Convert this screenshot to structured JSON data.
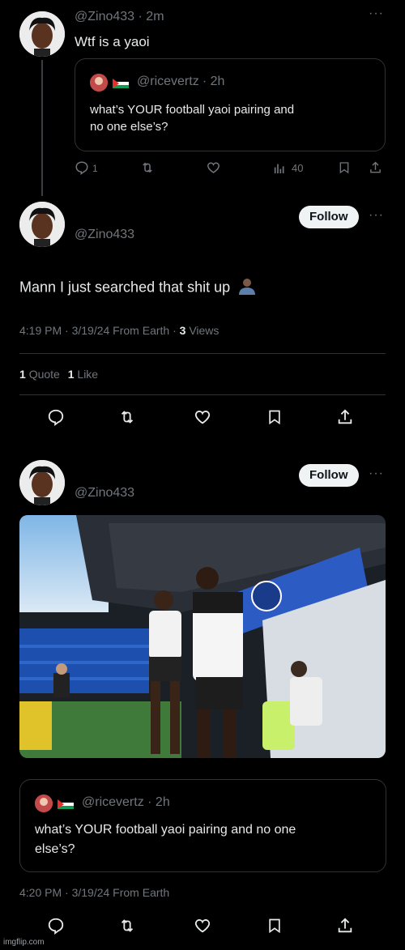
{
  "tweet1": {
    "handle": "@Zino433",
    "time": "· 2m",
    "text": "Wtf is a yaoi",
    "quote": {
      "handle": "@ricevertz",
      "time": "· 2h",
      "text_line1": "what’s YOUR football yaoi pairing and",
      "text_line2": "no one else’s?"
    },
    "reply_count": "1",
    "views_count": "40"
  },
  "tweet2": {
    "follow_label": "Follow",
    "handle": "@Zino433",
    "text": "Mann I just searched that shit up",
    "meta": "4:19 PM · 3/19/24 From Earth · ",
    "views_number": "3",
    "views_label": " Views",
    "quote_count": "1",
    "quote_label": "Quote",
    "like_count": "1",
    "like_label": "Like"
  },
  "tweet3": {
    "follow_label": "Follow",
    "handle": "@Zino433",
    "quote": {
      "handle": "@ricevertz",
      "time": "· 2h",
      "text_line1": "what’s YOUR football yaoi pairing and no one",
      "text_line2": "else’s?"
    },
    "meta": "4:20 PM · 3/19/24 From Earth"
  },
  "watermark": "imgflip.com",
  "colors": {
    "background": "#000000",
    "text": "#e7e9ea",
    "muted": "#71767b",
    "border": "#2f3336"
  },
  "icons": [
    "reply-icon",
    "retweet-icon",
    "like-icon",
    "views-icon",
    "bookmark-icon",
    "share-icon",
    "more-icon"
  ]
}
